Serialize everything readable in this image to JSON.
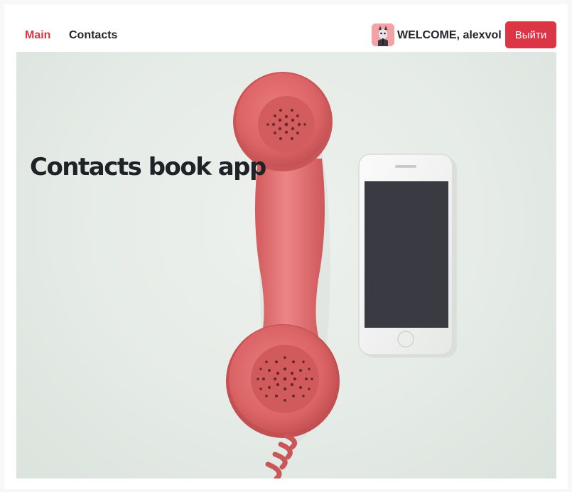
{
  "navbar": {
    "links": [
      {
        "label": "Main",
        "active": true
      },
      {
        "label": "Contacts",
        "active": false
      }
    ],
    "welcome_text": "WELCOME, alexvol",
    "logout_label": "Выйти",
    "avatar_icon": "user-avatar-icon"
  },
  "hero": {
    "title": "Contacts book app",
    "image": "red-telephone-handset-and-smartphone"
  },
  "colors": {
    "accent": "#dc3545",
    "text": "#212529",
    "hero_bg": "#e5ebe6",
    "handset": "#e06a6c"
  }
}
